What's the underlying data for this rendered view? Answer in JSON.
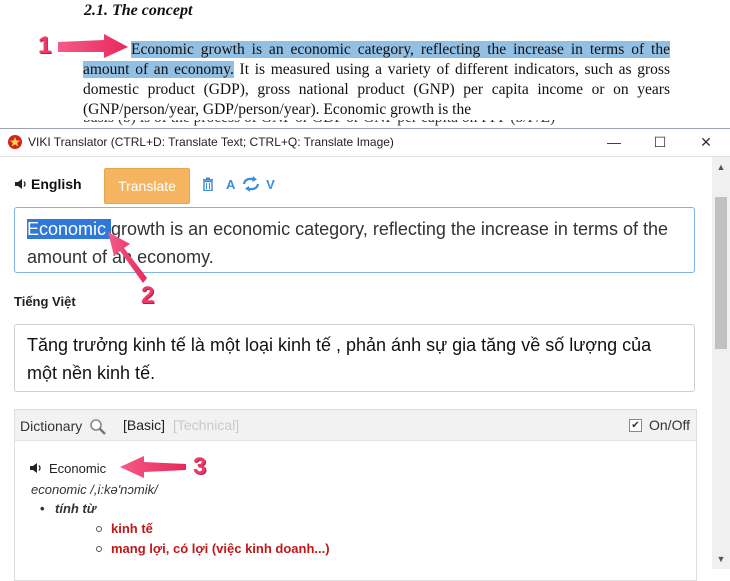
{
  "document": {
    "heading": "2.1. The concept",
    "selected_text": "Economic growth is an economic category, reflecting the increase in terms of the amount of an economy.",
    "rest_text": " It is measured using a variety of different indicators, such as gross domestic product (GDP), gross national product (GNP) per capita income or on years (GNP/person/year, GDP/person/year). Economic growth is the",
    "cut_line": "basis (b) is of the process of GNP or GDP or GNP per capita on PPP (b/P/E)"
  },
  "window": {
    "title": "VIKI Translator (CTRL+D: Translate Text; CTRL+Q: Translate Image)",
    "controls": {
      "minimize": "—",
      "maximize": "☐",
      "close": "✕"
    }
  },
  "toolbar": {
    "source_lang": "English",
    "translate_label": "Translate",
    "swap_from": "A",
    "swap_to": "V"
  },
  "source": {
    "highlight_word": "Economic ",
    "text_rest": "growth is an economic category, reflecting the increase in terms of the amount of an economy."
  },
  "target": {
    "lang": "Tiếng Việt",
    "text": "Tăng trưởng kinh tế là một loại kinh tế , phản ánh sự gia tăng về số lượng của một nền kinh tế."
  },
  "dictionary": {
    "label": "Dictionary",
    "tab_basic": "[Basic]",
    "tab_technical": "[Technical]",
    "onoff_label": "On/Off",
    "onoff_checked": "✔",
    "entry": {
      "word": "Economic",
      "phonetic": "economic /,i:kə'nɔmik/",
      "pos": "tính từ",
      "meanings": [
        "kinh tế",
        "mang lợi, có lợi (việc kinh doanh...)"
      ]
    }
  },
  "scroll": {
    "up": "▲",
    "down": "▼"
  },
  "annotations": [
    "1",
    "2",
    "3"
  ],
  "colors": {
    "accent": "#f5b45f",
    "annotation": "#ee3a6a",
    "highlight": "#92bfe4",
    "selection": "#2f78d8"
  }
}
